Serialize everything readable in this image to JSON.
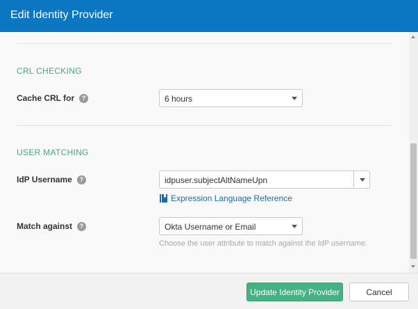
{
  "dialog": {
    "title": "Edit Identity Provider"
  },
  "sections": {
    "crl": {
      "title": "CRL CHECKING",
      "cache_label": "Cache CRL for",
      "cache_value": "6 hours"
    },
    "user_matching": {
      "title": "USER MATCHING",
      "idp_username_label": "IdP Username",
      "idp_username_value": "idpuser.subjectAltNameUpn",
      "el_link": "Expression Language Reference",
      "match_against_label": "Match against",
      "match_against_value": "Okta Username or Email",
      "match_hint": "Choose the user attribute to match against the IdP username."
    }
  },
  "help_glyph": "?",
  "footer": {
    "primary_label": "Update Identity Provider",
    "cancel_label": "Cancel"
  },
  "colors": {
    "header": "#0b76c1",
    "section_title": "#47a389",
    "link": "#1a6ca8",
    "primary_button": "#47b184"
  },
  "icons": [
    "help-icon",
    "chevron-down-icon",
    "book-icon"
  ]
}
